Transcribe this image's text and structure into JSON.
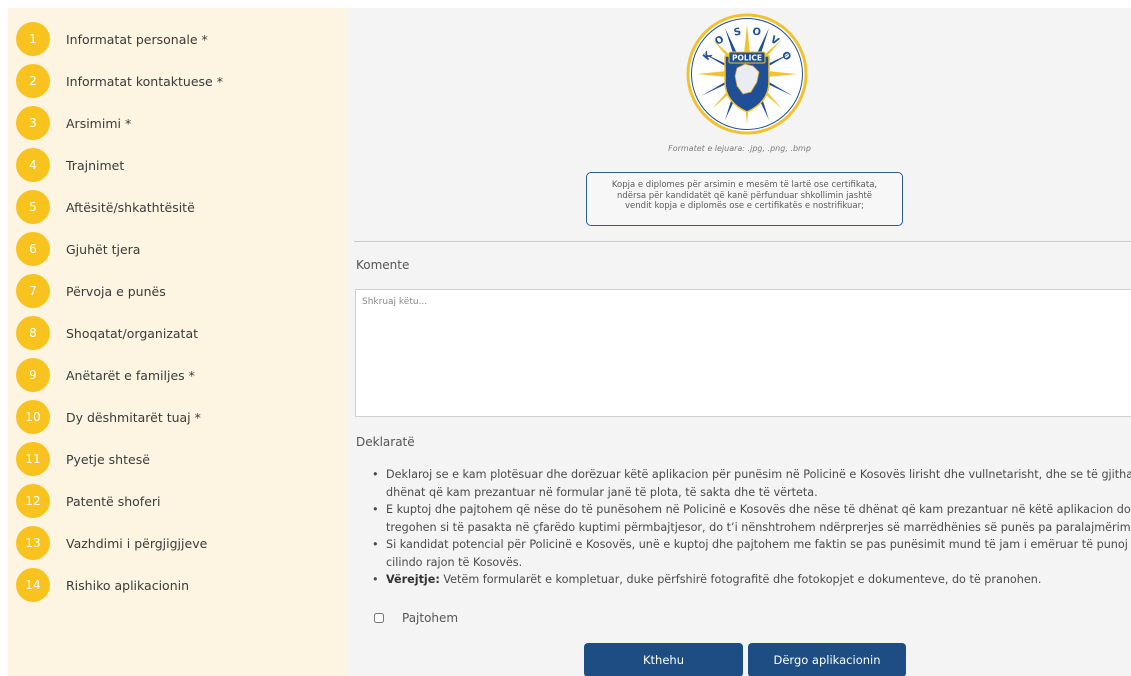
{
  "sidebar": {
    "steps": [
      {
        "num": "1",
        "label": "Informatat personale *"
      },
      {
        "num": "2",
        "label": "Informatat kontaktuese *"
      },
      {
        "num": "3",
        "label": "Arsimimi *"
      },
      {
        "num": "4",
        "label": "Trajnimet"
      },
      {
        "num": "5",
        "label": "Aftësitë/shkathtësitë"
      },
      {
        "num": "6",
        "label": "Gjuhët tjera"
      },
      {
        "num": "7",
        "label": "Përvoja e punës"
      },
      {
        "num": "8",
        "label": "Shoqatat/organizatat"
      },
      {
        "num": "9",
        "label": "Anëtarët e familjes *"
      },
      {
        "num": "10",
        "label": "Dy dëshmitarët tuaj *"
      },
      {
        "num": "11",
        "label": "Pyetje shtesë"
      },
      {
        "num": "12",
        "label": "Patentë shoferi"
      },
      {
        "num": "13",
        "label": "Vazhdimi i përgjigjjeve"
      },
      {
        "num": "14",
        "label": "Rishiko aplikacionin"
      }
    ]
  },
  "logo": {
    "letters": [
      "K",
      "O",
      "S",
      "O",
      "V",
      "O"
    ],
    "banner": "POLICE"
  },
  "upload": {
    "formats": "Formatet e lejuara: .jpg, .png, .bmp",
    "info_line1": "Kopja e diplomes për arsimin e mesëm të lartë ose certifikata,",
    "info_line2": "ndërsa për kandidatët që kanë përfunduar shkollimin jashtë",
    "info_line3": "vendit kopja e diplomës ose e certifikatës e nostrifikuar;"
  },
  "comments": {
    "label": "Komente",
    "placeholder": "Shkruaj këtu..."
  },
  "declaration": {
    "label": "Deklaratë",
    "items": [
      {
        "line1": "Deklaroj se e kam plotësuar dhe dorëzuar këtë aplikacion për punësim në Policinë e Kosovës lirisht dhe vullnetarisht, dhe se të gjitha të",
        "line2": "dhënat që kam prezantuar në formular janë të plota, të sakta dhe të vërteta."
      },
      {
        "line1": "E kuptoj dhe pajtohem që nëse do të punësohem në Policinë e Kosovës dhe nëse të dhënat që kam prezantuar në këtë aplikacion do të",
        "line2": "tregohen si të pasakta në çfarëdo kuptimi përmbajtjesor, do t’i nënshtrohem ndërprerjes së marrëdhënies së punës pa paralajmërim."
      },
      {
        "line1": "Si kandidat potencial për Policinë e Kosovës, unë e kuptoj dhe pajtohem me faktin se pas punësimit mund të jam i emëruar të punoj në",
        "line2": "cilindo rajon të Kosovës."
      }
    ],
    "note_bold": "Vërejtje:",
    "note_text": " Vetëm formularët e kompletuar, duke përfshirë fotografitë dhe fotokopjet e dokumenteve, do të pranohen."
  },
  "agree_label": "Pajtohem",
  "buttons": {
    "back": "Kthehu",
    "send": "Dërgo aplikacionin"
  },
  "colors": {
    "step_circle": "#f9c31f",
    "sidebar_bg": "#fdf5e1",
    "primary": "#1e4d84",
    "logo_blue": "#1f4f96",
    "logo_gold": "#f2c12e"
  }
}
